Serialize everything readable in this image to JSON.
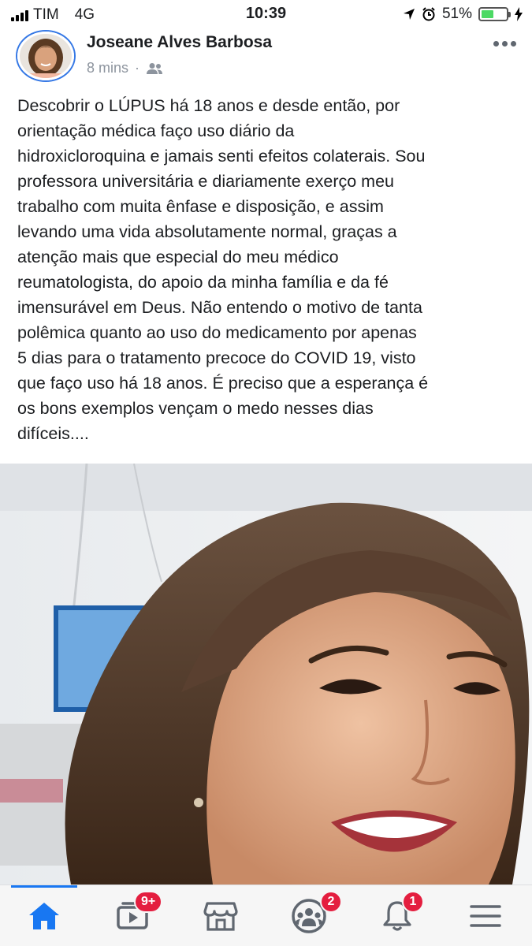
{
  "status_bar": {
    "carrier": "TIM",
    "network": "4G",
    "time": "10:39",
    "battery_percent": "51%",
    "battery_level": 0.51
  },
  "post": {
    "author": "Joseane Alves Barbosa",
    "time_ago": "8 mins",
    "separator": "·",
    "audience_icon": "friends-icon",
    "text": "Descobrir o LÚPUS há 18 anos e desde então, por\norientação médica faço uso diário da\nhidroxicloroquina e jamais senti efeitos colaterais. Sou\nprofessora universitária e diariamente exerço meu\ntrabalho com muita ênfase e disposição, e assim\nlevando uma vida absolutamente normal, graças a\natenção mais que especial do meu médico\nreumatologista, do apoio da minha família e da fé\nimensurável em Deus. Não entendo o motivo de tanta\npolêmica quanto ao uso do medicamento por apenas\n5 dias para o tratamento precoce do COVID 19, visto\nque faço uso há 18 anos. É preciso que a esperança é\nos bons exemplos vençam o medo nesses dias\ndifíceis...."
  },
  "bottom_nav": {
    "items": [
      {
        "icon": "home-icon",
        "active": true
      },
      {
        "icon": "watch-icon",
        "badge": "9+"
      },
      {
        "icon": "marketplace-icon"
      },
      {
        "icon": "groups-icon",
        "badge": "2"
      },
      {
        "icon": "notifications-icon",
        "badge": "1"
      },
      {
        "icon": "menu-icon"
      }
    ]
  },
  "colors": {
    "accent": "#1877f2",
    "badge": "#e41e3f",
    "battery": "#4cd964"
  }
}
